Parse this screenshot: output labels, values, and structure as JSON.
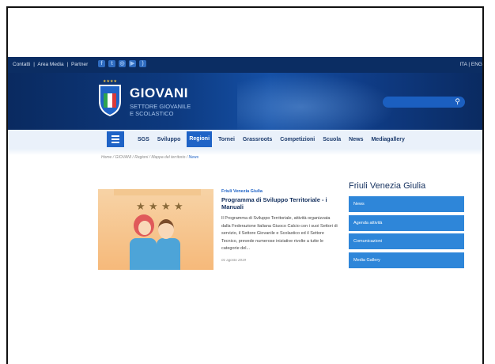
{
  "topbar": {
    "links": [
      "Contatti",
      "|",
      "Area Media",
      "|",
      "Partner"
    ],
    "language": "ITA | ENG"
  },
  "social_icons": [
    "facebook-icon",
    "twitter-icon",
    "instagram-icon",
    "youtube-icon",
    "rss-icon"
  ],
  "header": {
    "title": "GIOVANI",
    "subtitle_line1": "SETTORE GIOVANILE",
    "subtitle_line2": "E SCOLASTICO",
    "logo_text": "ITALIA"
  },
  "nav": {
    "items": [
      "SGS",
      "Sviluppo",
      "Regioni",
      "Tornei",
      "Grassroots",
      "Competizioni",
      "Scuola",
      "News",
      "Mediagallery"
    ],
    "active": "Regioni"
  },
  "breadcrumb": {
    "path": "Home / GIOVANI / Regioni / Mappa del territorio / ",
    "current": "News"
  },
  "article": {
    "region": "Friuli Venezia Giulia",
    "title": "Programma di Sviluppo Territoriale - i Manuali",
    "excerpt": "Il Programma di Sviluppo Territoriale, attività organizzata dalla Federazione Italiana Giuoco Calcio con i suoi Settori di servizio, il Settore Giovanile e Scolastico ed il Settore Tecnico, prevede numerose iniziative rivolte a tutte le categorie del...",
    "date": "01 agosto 2019"
  },
  "sidebar": {
    "title": "Friuli Venezia Giulia",
    "items": [
      "News",
      "Agenda attività",
      "Comunicazioni",
      "Media Gallery"
    ]
  },
  "colors": {
    "topbar": "#0b2d63",
    "accent": "#1f63c6",
    "sidebar_item": "#2e86d9"
  }
}
